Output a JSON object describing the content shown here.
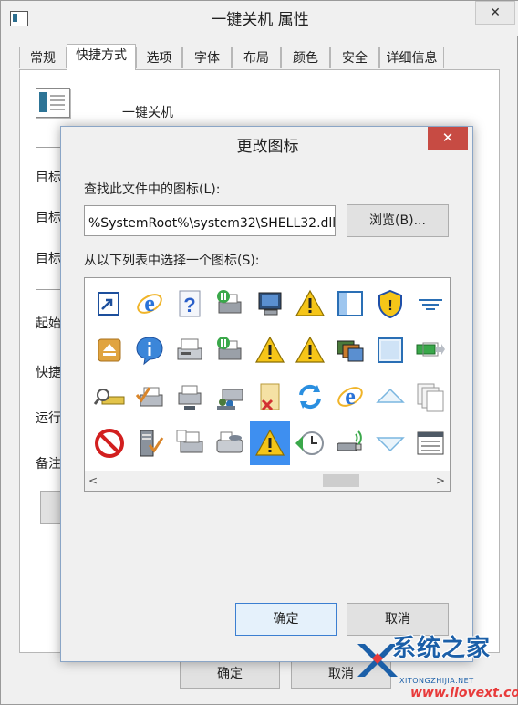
{
  "window": {
    "title": "一键关机 属性",
    "close_label": "✕"
  },
  "tabs": [
    {
      "label": "常规"
    },
    {
      "label": "快捷方式"
    },
    {
      "label": "选项"
    },
    {
      "label": "字体"
    },
    {
      "label": "布局"
    },
    {
      "label": "颜色"
    },
    {
      "label": "安全"
    },
    {
      "label": "详细信息"
    }
  ],
  "shortcut_page": {
    "app_name": "一键关机",
    "side_labels": [
      "目标",
      "目标",
      "目标",
      "起始",
      "快捷",
      "运行",
      "备注"
    ]
  },
  "dialog": {
    "title": "更改图标",
    "close_label": "✕",
    "find_label": "查找此文件中的图标(L):",
    "path_value": "%SystemRoot%\\system32\\SHELL32.dll",
    "browse_label": "浏览(B)...",
    "select_label": "从以下列表中选择一个图标(S):",
    "scroll_left": "<",
    "scroll_right": ">",
    "ok_label": "确定",
    "cancel_label": "取消",
    "selected_icon": "warning-icon",
    "icons": [
      [
        "shortcut-window-icon",
        "internet-explorer-icon",
        "help-document-icon",
        "printer-paused-icon",
        "computer-monitor-icon",
        "warning-icon",
        "window-panel-icon",
        "security-shield-icon",
        "filter-lines-icon"
      ],
      [
        "drive-eject-icon",
        "info-icon",
        "fax-printer-icon",
        "printer-paused-icon",
        "warning-icon",
        "warning-icon",
        "photo-slideshow-icon",
        "blank-frame-icon",
        "battery-arrow-icon"
      ],
      [
        "scanner-search-icon",
        "printer-check-icon",
        "printer-network-icon",
        "printer-users-icon",
        "file-delete-icon",
        "sync-arrows-icon",
        "internet-explorer-icon",
        "triangle-up-icon",
        "pages-stack-icon"
      ],
      [
        "no-entry-icon",
        "server-check-icon",
        "printer-document-icon",
        "fax-machine-icon",
        "warning-icon",
        "clock-back-icon",
        "usb-wireless-icon",
        "triangle-down-icon",
        "window-list-icon"
      ]
    ]
  },
  "main_buttons": {
    "ok_label": "确定",
    "cancel_label": "取消"
  },
  "watermark": {
    "brand": "系统之家",
    "sub": "XITONGZHIJIA.NET",
    "url": "www.ilovext.com"
  },
  "colors": {
    "selection": "#3e8ff0",
    "dialog_close": "#c74b43",
    "watermark_blue": "#1b5fa8",
    "watermark_red": "#e83b3b"
  }
}
